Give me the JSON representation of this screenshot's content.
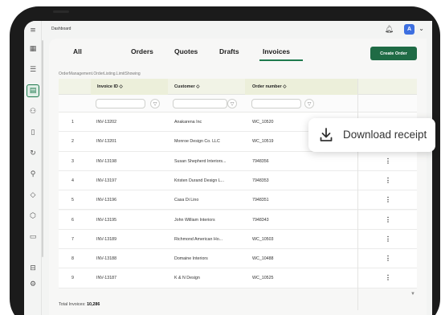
{
  "topbar": {
    "breadcrumb": "Dashboard",
    "avatar_initial": "A"
  },
  "sidebar": {
    "items": [
      {
        "icon": "menu-icon",
        "glyph": "≡"
      },
      {
        "icon": "grid-icon",
        "glyph": "▦"
      },
      {
        "icon": "list-icon",
        "glyph": "☰"
      },
      {
        "icon": "document-icon",
        "glyph": "▤",
        "active": true
      },
      {
        "icon": "users-icon",
        "glyph": "⚇"
      },
      {
        "icon": "file-icon",
        "glyph": "▯"
      },
      {
        "icon": "refresh-icon",
        "glyph": "↻"
      },
      {
        "icon": "user-settings-icon",
        "glyph": "⚲"
      },
      {
        "icon": "tag-icon",
        "glyph": "◇"
      },
      {
        "icon": "box-icon",
        "glyph": "⬡"
      },
      {
        "icon": "folder-icon",
        "glyph": "▭"
      },
      {
        "icon": "inbox-icon",
        "glyph": "⊟"
      },
      {
        "icon": "gear-icon",
        "glyph": "⚙"
      }
    ]
  },
  "tabs": [
    {
      "label": "All"
    },
    {
      "label": "Orders"
    },
    {
      "label": "Quotes"
    },
    {
      "label": "Drafts"
    },
    {
      "label": "Invoices",
      "active": true
    }
  ],
  "create_button": "Create Order",
  "subcrumb": "OrderManagement.OrderListing.LimitShowing",
  "table": {
    "headers": {
      "invoice_id": "Invoice ID ◇",
      "customer": "Customer ◇",
      "order_number": "Order number ◇"
    },
    "rows": [
      {
        "index": "1",
        "invoice": "INV-13202",
        "customer": "Anakarena Inc",
        "order": "WC_10520"
      },
      {
        "index": "2",
        "invoice": "INV-13201",
        "customer": "Monroe Design Co. LLC",
        "order": "WC_10519"
      },
      {
        "index": "3",
        "invoice": "INV-13198",
        "customer": "Susan Shepherd Interiors...",
        "order": "7948356"
      },
      {
        "index": "4",
        "invoice": "INV-13197",
        "customer": "Kristen Durand Design L...",
        "order": "7948353"
      },
      {
        "index": "5",
        "invoice": "INV-13196",
        "customer": "Casa Di Lino",
        "order": "7948351"
      },
      {
        "index": "6",
        "invoice": "INV-13195",
        "customer": "John William Interiors",
        "order": "7948343"
      },
      {
        "index": "7",
        "invoice": "INV-13189",
        "customer": "Richmond American Ho...",
        "order": "WC_10503"
      },
      {
        "index": "8",
        "invoice": "INV-13188",
        "customer": "Domaine Interiors",
        "order": "WC_10488"
      },
      {
        "index": "9",
        "invoice": "INV-13187",
        "customer": "K & N Design",
        "order": "WC_10525"
      }
    ]
  },
  "footer": {
    "label": "Total Invoices:",
    "value": "10,286"
  },
  "popup": {
    "label": "Download receipt",
    "icon": "download-icon"
  }
}
